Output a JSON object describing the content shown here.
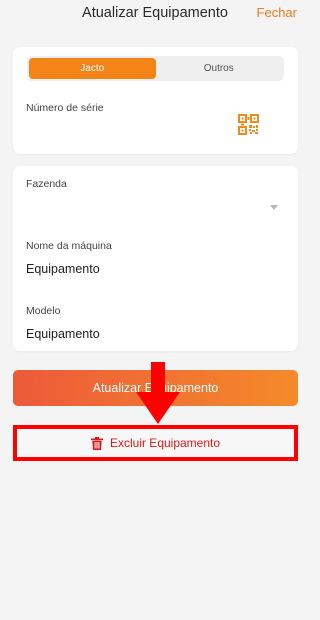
{
  "header": {
    "title": "Atualizar Equipamento",
    "close_label": "Fechar"
  },
  "tabs": [
    {
      "label": "Jacto",
      "active": true
    },
    {
      "label": "Outros",
      "active": false
    }
  ],
  "serial": {
    "label": "Número de série",
    "value": "",
    "icon": "qr-code-icon"
  },
  "fields": {
    "farm": {
      "label": "Fazenda",
      "value": ""
    },
    "machine_name": {
      "label": "Nome da máquina",
      "value": "Equipamento"
    },
    "model": {
      "label": "Modelo",
      "value": "Equipamento"
    }
  },
  "actions": {
    "update_label": "Atualizar Equipamento",
    "delete_label": "Excluir Equipamento"
  },
  "colors": {
    "accent": "#f48418",
    "danger": "#d81a1a",
    "annotation": "#ff0000"
  }
}
